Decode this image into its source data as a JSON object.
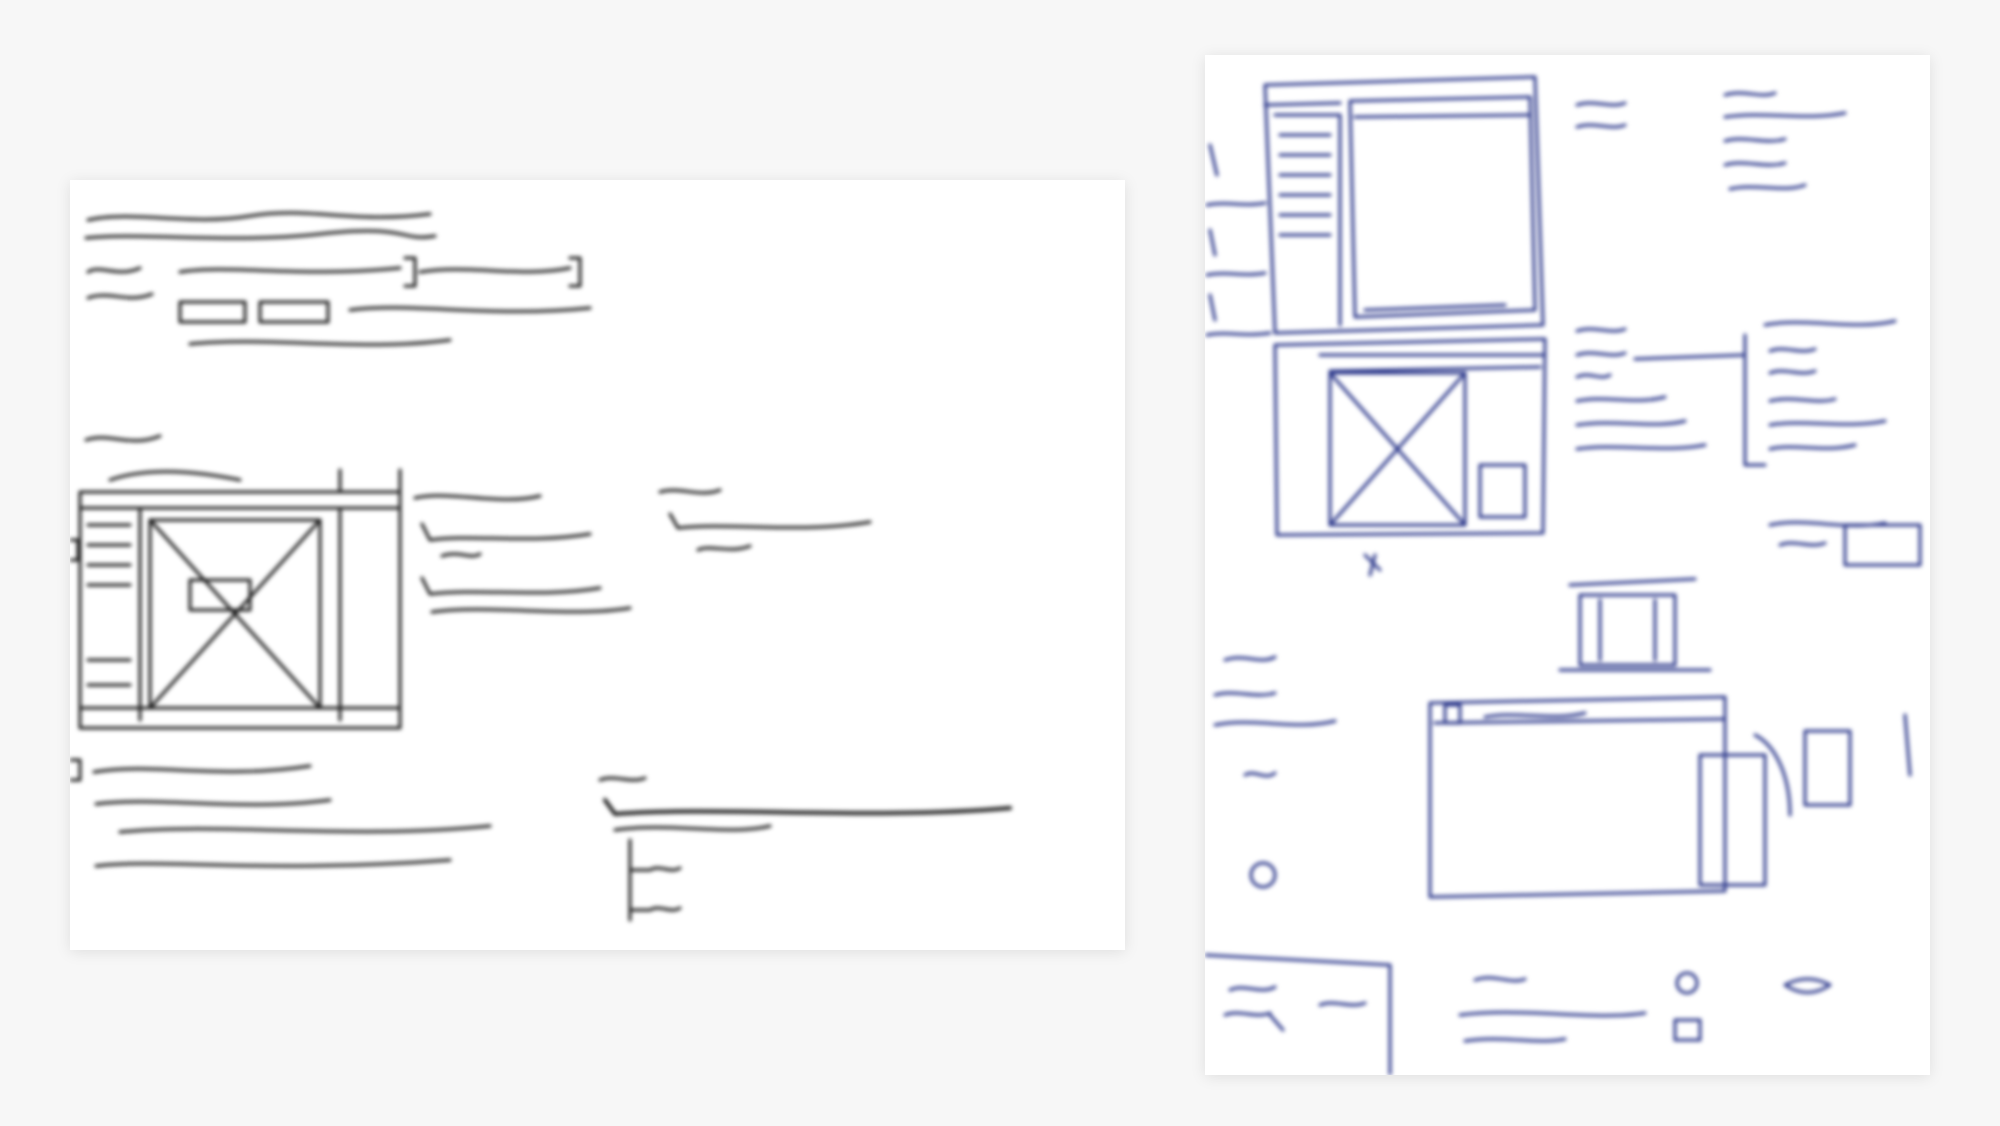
{
  "canvas": {
    "background": "#f7f7f7",
    "paper": "#ffffff",
    "pencil_ink": "#1c1c1c",
    "pen_ink": "#2e3a8c"
  },
  "sheets": [
    {
      "id": "left",
      "kind": "hand-drawn wireframe sketch",
      "legible_text": []
    },
    {
      "id": "right",
      "kind": "hand-drawn wireframe sketch",
      "legible_text": []
    }
  ]
}
